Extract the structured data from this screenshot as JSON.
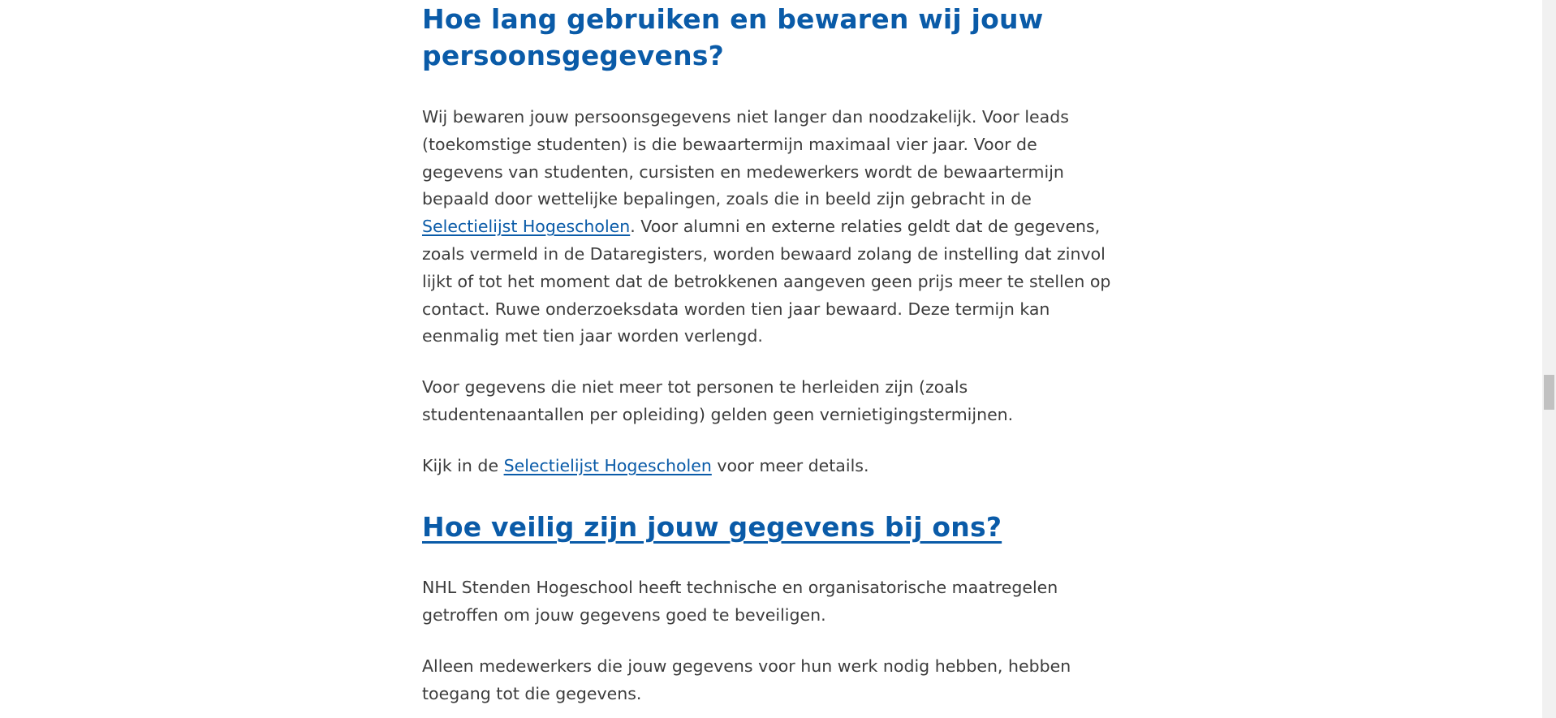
{
  "section1": {
    "heading": "Hoe lang gebruiken en bewaren wij jouw persoonsgegevens?",
    "p1_part1": "Wij bewaren jouw persoonsgegevens niet langer dan noodzakelijk. Voor leads (toekomstige studenten) is die bewaartermijn maximaal vier jaar. Voor de gegevens van studenten, cursisten en medewerkers wordt de bewaartermijn bepaald door wettelijke bepalingen, zoals die in beeld zijn gebracht in de ",
    "p1_link": "Selectielijst Hogescholen",
    "p1_part2": ". Voor alumni en externe relaties geldt dat de gegevens, zoals vermeld in de Dataregisters, worden bewaard zolang de instelling dat zinvol lijkt of tot het moment dat de betrokkenen aangeven geen prijs meer te stellen op contact. Ruwe onderzoeksdata worden tien jaar bewaard. Deze termijn kan eenmalig met tien jaar worden verlengd.",
    "p2": "Voor gegevens die niet meer tot personen te herleiden zijn (zoals studentenaantallen per opleiding) gelden geen vernietigingstermijnen.",
    "p3_part1": "Kijk in de ",
    "p3_link": "Selectielijst Hogescholen",
    "p3_part2": " voor meer details."
  },
  "section2": {
    "heading": "Hoe veilig zijn jouw gegevens bij ons?",
    "p1": "NHL Stenden Hogeschool heeft technische en organisatorische maatregelen getroffen om jouw gegevens goed te beveiligen.",
    "p2": "Alleen medewerkers die jouw gegevens voor hun werk nodig hebben, hebben toegang tot die gegevens."
  },
  "colors": {
    "heading": "#0a5ba8",
    "link": "#0a5ba8",
    "body_text": "#3c3c3c",
    "scrollbar_track": "#f1f1f1",
    "scrollbar_thumb": "#c1c1c1"
  }
}
